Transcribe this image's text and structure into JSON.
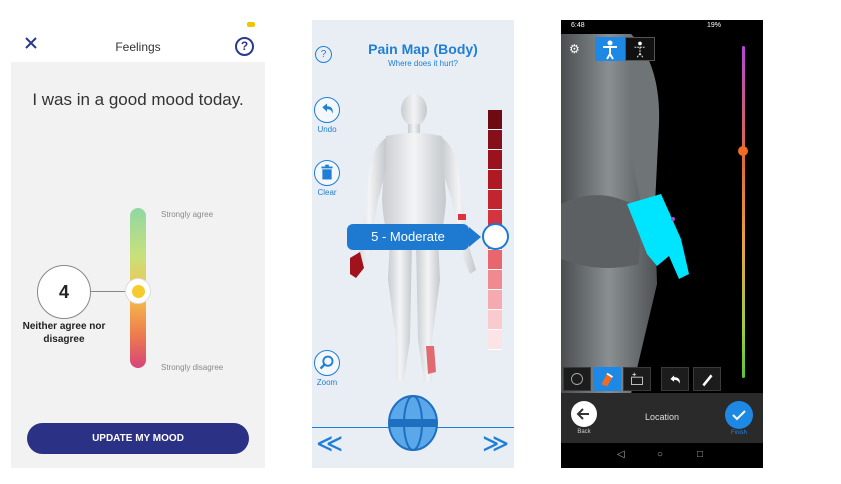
{
  "feelings": {
    "title": "Feelings",
    "close_symbol": "✕",
    "help_symbol": "?",
    "statement": "I was in a good mood today.",
    "value": "4",
    "value_label": "Neither agree nor disagree",
    "scale_top": "Strongly agree",
    "scale_bottom": "Strongly disagree",
    "slider_level_percent": 57,
    "update_button": "UPDATE MY MOOD",
    "colors": {
      "button": "#2b3286",
      "thumb": "#f4cc2b"
    }
  },
  "pain_map": {
    "title": "Pain Map (Body)",
    "subtitle": "Where does it hurt?",
    "help_symbol": "?",
    "undo_label": "Undo",
    "clear_label": "Clear",
    "zoom_label": "Zoom",
    "severity": "5 - Moderate",
    "nav_prev": "≪",
    "nav_next": "≫",
    "colors": {
      "accent": "#1e7ad0",
      "pain": "#b0121e"
    }
  },
  "location": {
    "status_time": "6:48",
    "status_right": "19%",
    "title": "Location",
    "back_label": "Back",
    "finish_label": "Finish",
    "colors": {
      "accent": "#1e88e5",
      "highlight": "#00e5ff"
    }
  }
}
